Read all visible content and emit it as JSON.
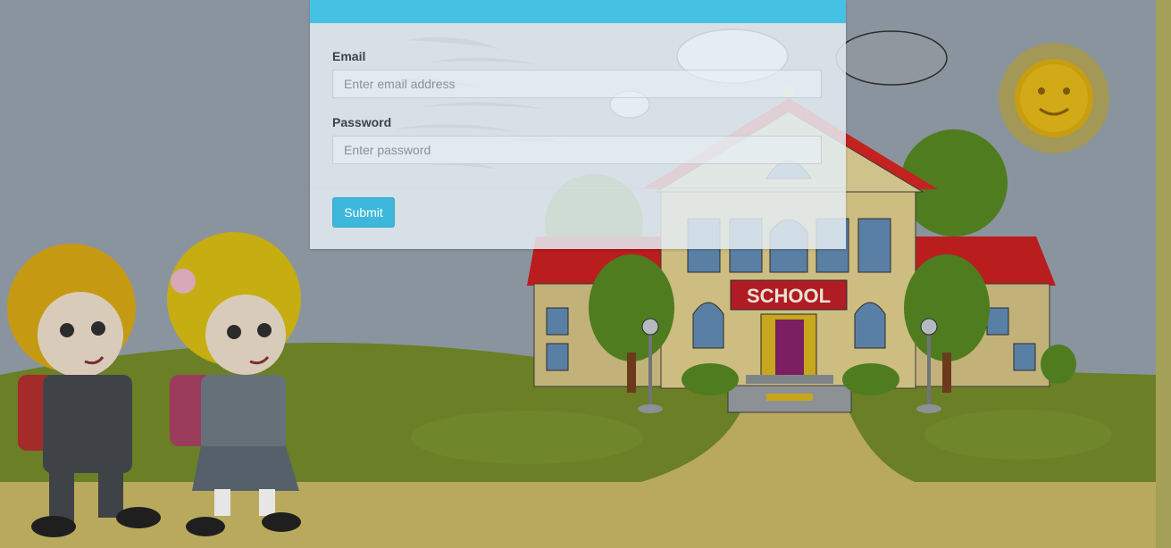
{
  "form": {
    "email_label": "Email",
    "email_placeholder": "Enter email address",
    "email_value": "",
    "password_label": "Password",
    "password_placeholder": "Enter password",
    "password_value": "",
    "submit_label": "Submit"
  },
  "background": {
    "sign_text": "SCHOOL"
  },
  "colors": {
    "header_accent": "#45c1e3",
    "submit_button": "#3db8dc",
    "sky": "#8a949e",
    "grass": "#6a7f26",
    "path": "#b9a95c",
    "roof": "#c81e1e"
  }
}
